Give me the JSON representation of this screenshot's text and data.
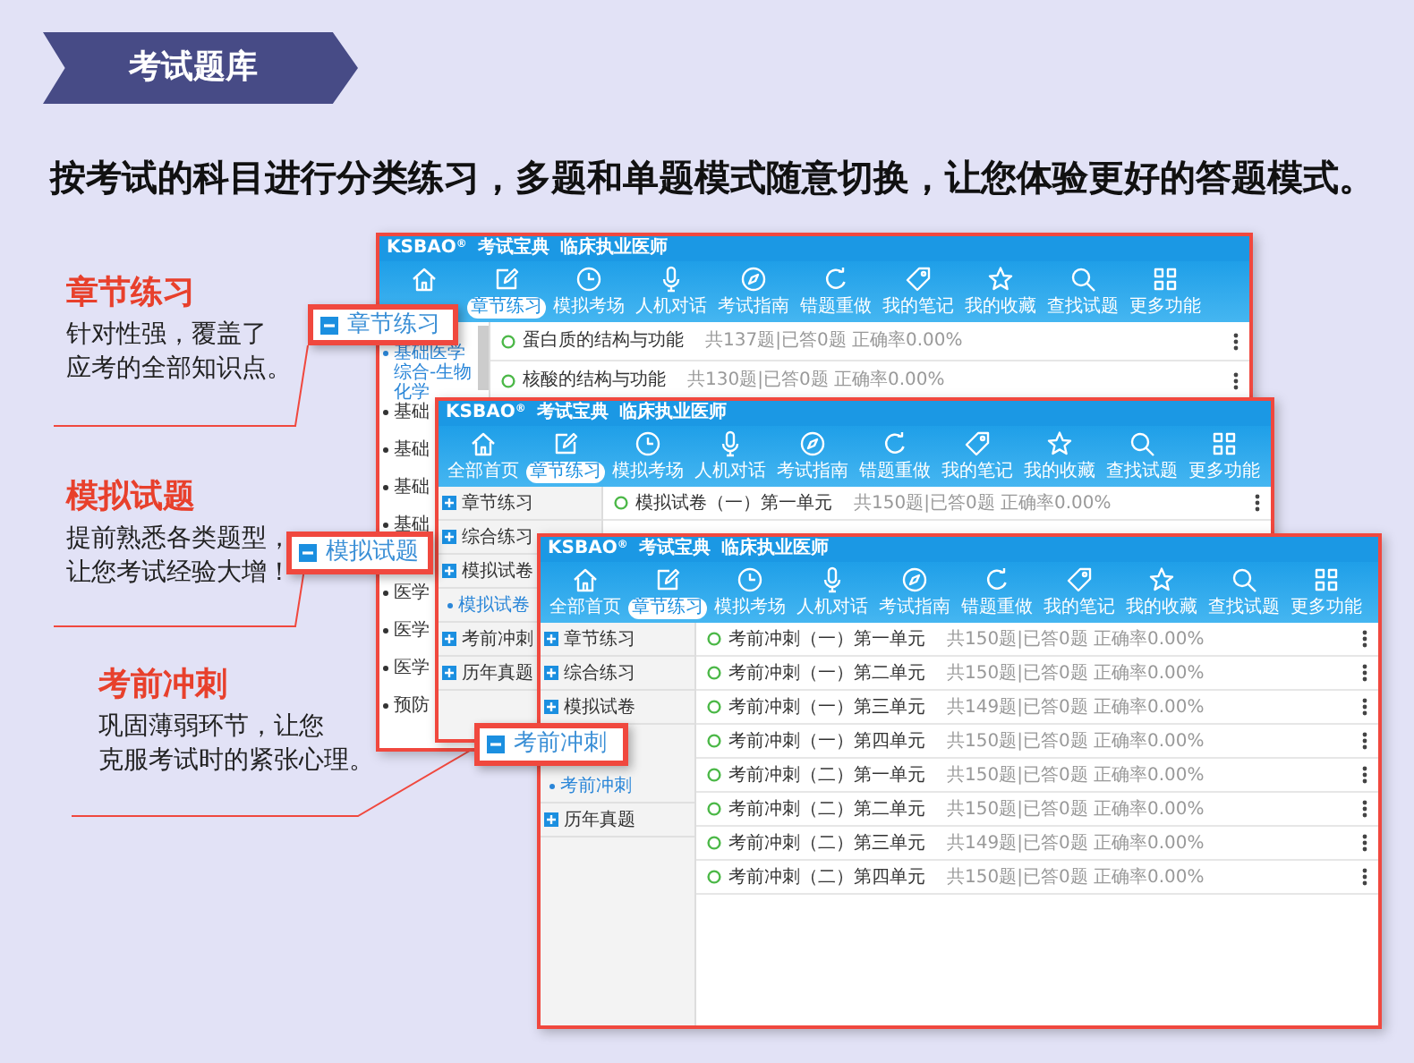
{
  "banner": {
    "title": "考试题库"
  },
  "subtitle": "按考试的科目进行分类练习，多题和单题模式随意切换，让您体验更好的答题模式。",
  "features": [
    {
      "title": "章节练习",
      "lines": [
        "针对性强，覆盖了",
        "应考的全部知识点。"
      ],
      "tag": "章节练习"
    },
    {
      "title": "模拟试题",
      "lines": [
        "提前熟悉各类题型，",
        "让您考试经验大增！"
      ],
      "tag": "模拟试题"
    },
    {
      "title": "考前冲刺",
      "lines": [
        "巩固薄弱环节，让您",
        "克服考试时的紧张心理。"
      ],
      "tag": "考前冲刺"
    }
  ],
  "windows": [
    {
      "brand": "KSBAO$^{®}$",
      "app": "考试宝典",
      "subject": "临床执业医师",
      "nav": [
        {
          "selected": false
        },
        {
          "label": "章节练习",
          "selected": true
        },
        {
          "label": "模拟考场",
          "selected": false
        },
        {
          "label": "人机对话",
          "selected": false
        },
        {
          "label": "考试指南",
          "selected": false
        },
        {
          "label": "错题重做",
          "selected": false
        },
        {
          "label": "我的笔记",
          "selected": false
        },
        {
          "label": "我的收藏",
          "selected": false
        },
        {
          "label": "查找试题",
          "selected": false
        },
        {
          "label": "更多功能",
          "selected": false
        }
      ],
      "sidebar": [
        {
          "kind": "sub",
          "label": "基础医学综合-生物化学",
          "selected": true
        },
        {
          "kind": "sub",
          "label": "基础",
          "selected": false
        },
        {
          "kind": "sub",
          "label": "基础",
          "selected": false
        },
        {
          "kind": "sub",
          "label": "基础",
          "selected": false
        },
        {
          "kind": "sub",
          "label": "基础",
          "selected": false
        },
        {
          "kind": "sub",
          "label": "医学",
          "selected": false
        },
        {
          "kind": "sub",
          "label": "医学",
          "selected": false
        },
        {
          "kind": "sub",
          "label": "医学",
          "selected": false
        },
        {
          "kind": "sub",
          "label": "预防",
          "selected": false
        }
      ],
      "rows": [
        {
          "title": "蛋白质的结构与功能",
          "meta": "共137题|已答0题  正确率0.00%"
        },
        {
          "title": "核酸的结构与功能",
          "meta": "共130题|已答0题  正确率0.00%"
        }
      ]
    },
    {
      "brand": "KSBAO$^{®}$",
      "app": "考试宝典",
      "subject": "临床执业医师",
      "nav": [
        {
          "label": "全部首页",
          "selected": false
        },
        {
          "label": "章节练习",
          "selected": true
        },
        {
          "label": "模拟考场",
          "selected": false
        },
        {
          "label": "人机对话",
          "selected": false
        },
        {
          "label": "考试指南",
          "selected": false
        },
        {
          "label": "错题重做",
          "selected": false
        },
        {
          "label": "我的笔记",
          "selected": false
        },
        {
          "label": "我的收藏",
          "selected": false
        },
        {
          "label": "查找试题",
          "selected": false
        },
        {
          "label": "更多功能",
          "selected": false
        }
      ],
      "sidebar": [
        {
          "kind": "group",
          "label": "章节练习",
          "selected": false
        },
        {
          "kind": "group",
          "label": "综合练习",
          "selected": false
        },
        {
          "kind": "group",
          "label": "模拟试卷",
          "selected": false
        },
        {
          "kind": "sub",
          "label": "模拟试卷",
          "selected": true
        },
        {
          "kind": "group",
          "label": "考前冲刺",
          "selected": false
        },
        {
          "kind": "group",
          "label": "历年真题",
          "selected": false
        }
      ],
      "rows": [
        {
          "title": "模拟试卷（一）第一单元",
          "meta": "共150题|已答0题  正确率0.00%"
        }
      ]
    },
    {
      "brand": "KSBAO$^{®}$",
      "app": "考试宝典",
      "subject": "临床执业医师",
      "nav": [
        {
          "label": "全部首页",
          "selected": false
        },
        {
          "label": "章节练习",
          "selected": true
        },
        {
          "label": "模拟考场",
          "selected": false
        },
        {
          "label": "人机对话",
          "selected": false
        },
        {
          "label": "考试指南",
          "selected": false
        },
        {
          "label": "错题重做",
          "selected": false
        },
        {
          "label": "我的笔记",
          "selected": false
        },
        {
          "label": "我的收藏",
          "selected": false
        },
        {
          "label": "查找试题",
          "selected": false
        },
        {
          "label": "更多功能",
          "selected": false
        }
      ],
      "sidebar": [
        {
          "kind": "group",
          "label": "章节练习",
          "selected": false
        },
        {
          "kind": "group",
          "label": "综合练习",
          "selected": false
        },
        {
          "kind": "group",
          "label": "模拟试卷",
          "selected": false
        },
        {
          "kind": "sub",
          "label": "考前冲刺",
          "selected": true
        },
        {
          "kind": "group",
          "label": "历年真题",
          "selected": false
        }
      ],
      "rows": [
        {
          "title": "考前冲刺（一）第一单元",
          "meta": "共150题|已答0题  正确率0.00%"
        },
        {
          "title": "考前冲刺（一）第二单元",
          "meta": "共150题|已答0题  正确率0.00%"
        },
        {
          "title": "考前冲刺（一）第三单元",
          "meta": "共149题|已答0题  正确率0.00%"
        },
        {
          "title": "考前冲刺（一）第四单元",
          "meta": "共150题|已答0题  正确率0.00%"
        },
        {
          "title": "考前冲刺（二）第一单元",
          "meta": "共150题|已答0题  正确率0.00%"
        },
        {
          "title": "考前冲刺（二）第二单元",
          "meta": "共150题|已答0题  正确率0.00%"
        },
        {
          "title": "考前冲刺（二）第三单元",
          "meta": "共149题|已答0题  正确率0.00%"
        },
        {
          "title": "考前冲刺（二）第四单元",
          "meta": "共150题|已答0题  正确率0.00%"
        }
      ]
    }
  ]
}
